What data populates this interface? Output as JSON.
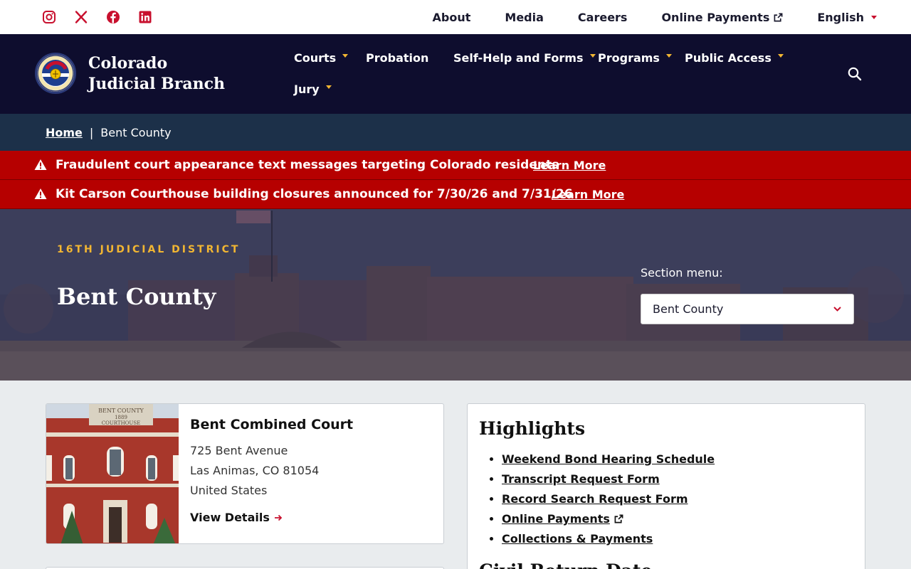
{
  "social": {
    "icons": [
      "instagram-icon",
      "x-icon",
      "facebook-icon",
      "linkedin-icon"
    ]
  },
  "utility_nav": {
    "about": "About",
    "media": "Media",
    "careers": "Careers",
    "online_payments": "Online Payments",
    "language": "English"
  },
  "header": {
    "brand": "Colorado Judicial Branch",
    "nav": {
      "courts": "Courts",
      "probation": "Probation",
      "self_help": "Self-Help and Forms",
      "programs": "Programs",
      "public_access": "Public Access",
      "jury": "Jury"
    }
  },
  "breadcrumb": {
    "home": "Home",
    "current": "Bent County"
  },
  "alerts": [
    {
      "message": "Fraudulent court appearance text messages targeting Colorado residents",
      "link": "Learn More"
    },
    {
      "message": "Kit Carson Courthouse building closures announced for 7/30/26 and 7/31/26",
      "link": "Learn More"
    }
  ],
  "hero": {
    "kicker": "16TH JUDICIAL DISTRICT",
    "title": "Bent County",
    "section_menu_label": "Section menu:",
    "section_menu_value": "Bent County"
  },
  "court_card": {
    "name": "Bent Combined Court",
    "address_line1": "725 Bent Avenue",
    "address_line2": "Las Animas, CO 81054",
    "address_line3": "United States",
    "details_link": "View Details",
    "photo_sign_line1": "BENT COUNTY",
    "photo_sign_line2": "1889",
    "photo_sign_line3": "COURTHOUSE"
  },
  "highlights": {
    "title": "Highlights",
    "links": [
      "Weekend Bond Hearing Schedule",
      "Transcript Request Form",
      "Record Search Request Form",
      "Online Payments",
      "Collections & Payments"
    ],
    "next_heading": "Civil Return Date"
  },
  "colors": {
    "navy": "#0e0d2e",
    "breadcrumb_bg": "#1c3049",
    "alert_red": "#b60000",
    "gold": "#f2b632",
    "social_red": "#c8102e"
  }
}
